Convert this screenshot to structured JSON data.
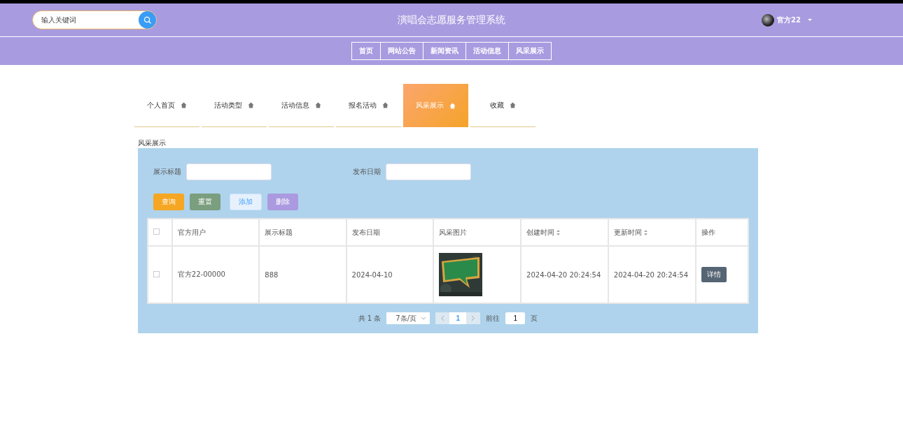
{
  "header": {
    "search": {
      "placeholder": "输入关键词"
    },
    "title": "演唱会志愿服务管理系统",
    "user": {
      "name": "官方22"
    }
  },
  "nav": [
    {
      "label": "首页"
    },
    {
      "label": "网站公告"
    },
    {
      "label": "新闻资讯"
    },
    {
      "label": "活动信息"
    },
    {
      "label": "风采展示"
    }
  ],
  "tabs": [
    {
      "label": "个人首页",
      "selected": false
    },
    {
      "label": "活动类型",
      "selected": false
    },
    {
      "label": "活动信息",
      "selected": false
    },
    {
      "label": "报名活动",
      "selected": false
    },
    {
      "label": "风采展示",
      "selected": true
    },
    {
      "label": "收藏",
      "selected": false
    }
  ],
  "section_title": "风采展示",
  "filters": [
    {
      "label": "展示标题"
    },
    {
      "label": "发布日期"
    }
  ],
  "buttons": [
    {
      "label": "查询",
      "kind": "query"
    },
    {
      "label": "重置",
      "kind": "reset"
    },
    {
      "label": "添加",
      "kind": "add"
    },
    {
      "label": "删除",
      "kind": "delete"
    }
  ],
  "table": {
    "all_checked": false,
    "columns": [
      {
        "label": "官方用户",
        "sortable": false
      },
      {
        "label": "展示标题",
        "sortable": false
      },
      {
        "label": "发布日期",
        "sortable": false
      },
      {
        "label": "风采图片",
        "sortable": false
      },
      {
        "label": "创建时间",
        "sortable": true
      },
      {
        "label": "更新时间",
        "sortable": true
      },
      {
        "label": "操作",
        "sortable": false
      }
    ],
    "rows": [
      {
        "checked": false,
        "cells": [
          "官方22-00000",
          "888",
          "2024-04-10",
          {
            "kind": "picture"
          },
          "2024-04-20 20:24:54",
          "2024-04-20 20:24:54"
        ],
        "action": "详情"
      }
    ]
  },
  "pagination": {
    "total": "共 1 条",
    "page_size": "7条/页",
    "current": "1",
    "goto_label": "前往",
    "goto_value": "1",
    "page_suffix": "页"
  }
}
